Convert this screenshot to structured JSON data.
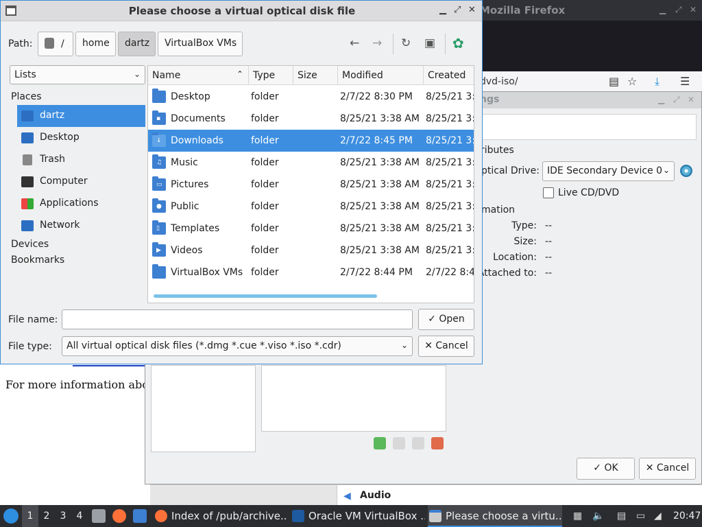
{
  "firefox": {
    "title": "Mozilla Firefox",
    "url_fragment": "dvd-iso/",
    "page_text": "For more information abo"
  },
  "vbox_settings": {
    "title_fragment": "ngs",
    "attributes_label": "ributes",
    "optical_drive_label": "ptical Drive:",
    "optical_drive_value": "IDE Secondary Device 0",
    "live_cd_label": "Live CD/DVD",
    "information_label": "mation",
    "info": [
      {
        "label": "Type:",
        "value": "--"
      },
      {
        "label": "Size:",
        "value": "--"
      },
      {
        "label": "Location:",
        "value": "--"
      },
      {
        "label": "Attached to:",
        "value": "--"
      }
    ],
    "ok_label": "OK",
    "cancel_label": "Cancel",
    "audio_label": "Audio"
  },
  "dialog": {
    "title": "Please choose a virtual optical disk file",
    "path_label": "Path:",
    "breadcrumbs": [
      "/",
      "home",
      "dartz",
      "VirtualBox VMs"
    ],
    "places_view": "Lists",
    "sidebar": {
      "places_header": "Places",
      "places": [
        {
          "label": "dartz",
          "icon": "home-icon"
        },
        {
          "label": "Desktop",
          "icon": "desktop-icon"
        },
        {
          "label": "Trash",
          "icon": "trash-icon"
        },
        {
          "label": "Computer",
          "icon": "computer-icon"
        },
        {
          "label": "Applications",
          "icon": "applications-icon"
        },
        {
          "label": "Network",
          "icon": "network-icon"
        }
      ],
      "devices_header": "Devices",
      "bookmarks_header": "Bookmarks"
    },
    "columns": [
      "Name",
      "Type",
      "Size",
      "Modified",
      "Created"
    ],
    "files": [
      {
        "name": "Desktop",
        "type": "folder",
        "size": "",
        "modified": "2/7/22 8:30 PM",
        "created": "8/25/21 3:",
        "icon": "desktop-icon"
      },
      {
        "name": "Documents",
        "type": "folder",
        "size": "",
        "modified": "8/25/21 3:38 AM",
        "created": "8/25/21 3:",
        "icon": "folder-documents-icon"
      },
      {
        "name": "Downloads",
        "type": "folder",
        "size": "",
        "modified": "2/7/22 8:45 PM",
        "created": "8/25/21 3:",
        "icon": "folder-downloads-icon"
      },
      {
        "name": "Music",
        "type": "folder",
        "size": "",
        "modified": "8/25/21 3:38 AM",
        "created": "8/25/21 3:",
        "icon": "folder-music-icon"
      },
      {
        "name": "Pictures",
        "type": "folder",
        "size": "",
        "modified": "8/25/21 3:38 AM",
        "created": "8/25/21 3:",
        "icon": "folder-pictures-icon"
      },
      {
        "name": "Public",
        "type": "folder",
        "size": "",
        "modified": "8/25/21 3:38 AM",
        "created": "8/25/21 3:",
        "icon": "folder-public-icon"
      },
      {
        "name": "Templates",
        "type": "folder",
        "size": "",
        "modified": "8/25/21 3:38 AM",
        "created": "8/25/21 3:",
        "icon": "folder-templates-icon"
      },
      {
        "name": "Videos",
        "type": "folder",
        "size": "",
        "modified": "8/25/21 3:38 AM",
        "created": "8/25/21 3:",
        "icon": "folder-videos-icon"
      },
      {
        "name": "VirtualBox VMs",
        "type": "folder",
        "size": "",
        "modified": "2/7/22 8:44 PM",
        "created": "2/7/22 8:4",
        "icon": "folder-icon"
      }
    ],
    "file_name_label": "File name:",
    "file_name_value": "",
    "open_label": "Open",
    "file_type_label": "File type:",
    "file_type_value": "All virtual optical disk files (*.dmg *.cue *.viso *.iso *.cdr)",
    "cancel_label": "Cancel"
  },
  "taskbar": {
    "workspaces": [
      "1",
      "2",
      "3",
      "4"
    ],
    "tasks": [
      {
        "label": "Index of /pub/archive...",
        "icon": "firefox-icon"
      },
      {
        "label": "Oracle VM VirtualBox ...",
        "icon": "virtualbox-icon"
      },
      {
        "label": "Please choose a virtu...",
        "icon": "window-icon"
      }
    ],
    "clock": "20:47"
  },
  "colors": {
    "selection": "#3d8ee0",
    "folder": "#3d7fd1",
    "taskbar": "#2b2c30"
  }
}
